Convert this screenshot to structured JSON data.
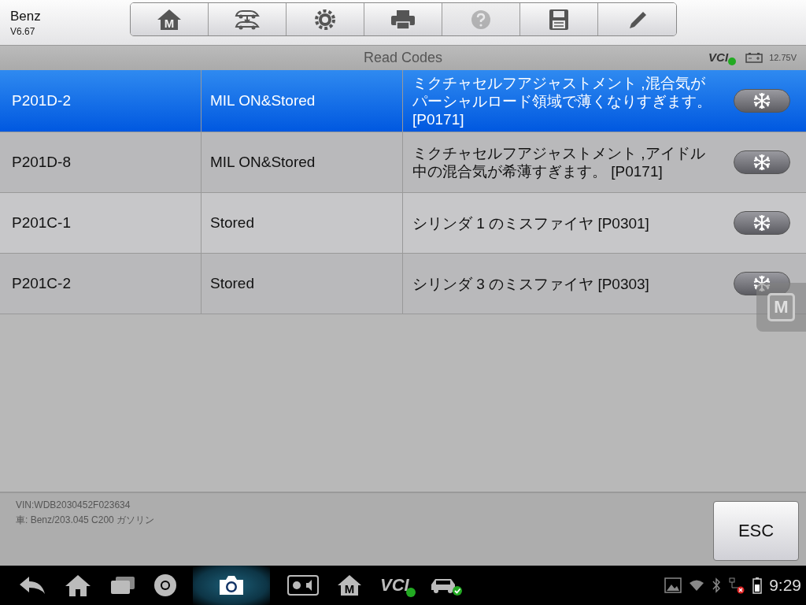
{
  "app": {
    "title": "Benz",
    "version": "V6.67"
  },
  "toolbar": [
    {
      "kind": "home",
      "letter": "M",
      "disabled": false
    },
    {
      "kind": "vehicle",
      "disabled": false
    },
    {
      "kind": "settings",
      "disabled": false
    },
    {
      "kind": "print",
      "disabled": false
    },
    {
      "kind": "help",
      "disabled": true
    },
    {
      "kind": "save",
      "disabled": false
    },
    {
      "kind": "edit",
      "disabled": false
    }
  ],
  "subheader": {
    "title": "Read Codes",
    "vci": "VCI",
    "voltage": "12.75V"
  },
  "codes": [
    {
      "code": "P201D-2",
      "status": "MIL ON&Stored",
      "description": "ミクチャセルフアジャストメント ,混合気がパーシャルロード領域で薄くなりすぎます。 [P0171]",
      "selected": true
    },
    {
      "code": "P201D-8",
      "status": "MIL ON&Stored",
      "description": "ミクチャセルフアジャストメント ,アイドル中の混合気が希薄すぎます。 [P0171]",
      "selected": false
    },
    {
      "code": "P201C-1",
      "status": "Stored",
      "description": "シリンダ 1 のミスファイヤ [P0301]",
      "selected": false
    },
    {
      "code": "P201C-2",
      "status": "Stored",
      "description": "シリンダ 3 のミスファイヤ [P0303]",
      "selected": false
    }
  ],
  "floating_button": {
    "letter": "M"
  },
  "footer": {
    "vin": "VIN:WDB2030452F023634",
    "vehicle": "車: Benz/203.045 C200 ガソリン",
    "esc": "ESC"
  },
  "navbar": {
    "home_letter": "M",
    "vci": "VCI",
    "time": "9:29"
  }
}
